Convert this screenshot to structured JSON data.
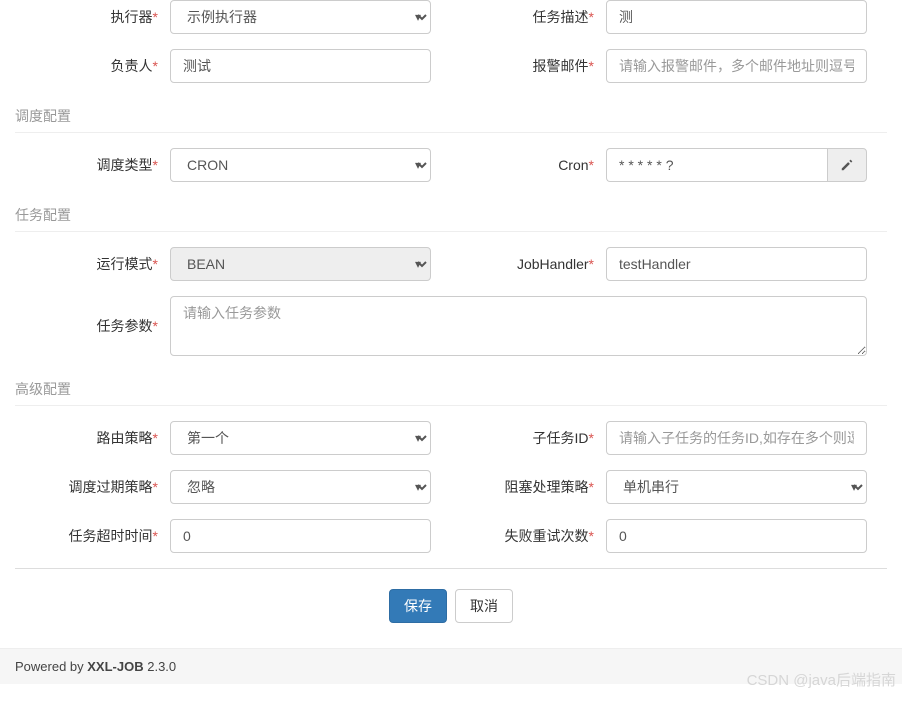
{
  "basic": {
    "executor_label": "执行器",
    "executor_value": "示例执行器",
    "desc_label": "任务描述",
    "desc_value": "测",
    "owner_label": "负责人",
    "owner_value": "测试",
    "alarm_label": "报警邮件",
    "alarm_placeholder": "请输入报警邮件，多个邮件地址则逗号分"
  },
  "schedule": {
    "section": "调度配置",
    "type_label": "调度类型",
    "type_value": "CRON",
    "cron_label": "Cron",
    "cron_value": "* * * * * ?"
  },
  "task": {
    "section": "任务配置",
    "mode_label": "运行模式",
    "mode_value": "BEAN",
    "handler_label": "JobHandler",
    "handler_value": "testHandler",
    "params_label": "任务参数",
    "params_placeholder": "请输入任务参数"
  },
  "advanced": {
    "section": "高级配置",
    "route_label": "路由策略",
    "route_value": "第一个",
    "child_label": "子任务ID",
    "child_placeholder": "请输入子任务的任务ID,如存在多个则逗",
    "expire_label": "调度过期策略",
    "expire_value": "忽略",
    "block_label": "阻塞处理策略",
    "block_value": "单机串行",
    "timeout_label": "任务超时时间",
    "timeout_value": "0",
    "retry_label": "失败重试次数",
    "retry_value": "0"
  },
  "actions": {
    "save": "保存",
    "cancel": "取消"
  },
  "footer": {
    "powered": "Powered by ",
    "product": "XXL-JOB",
    "version": " 2.3.0"
  },
  "watermark": "CSDN @java后端指南"
}
